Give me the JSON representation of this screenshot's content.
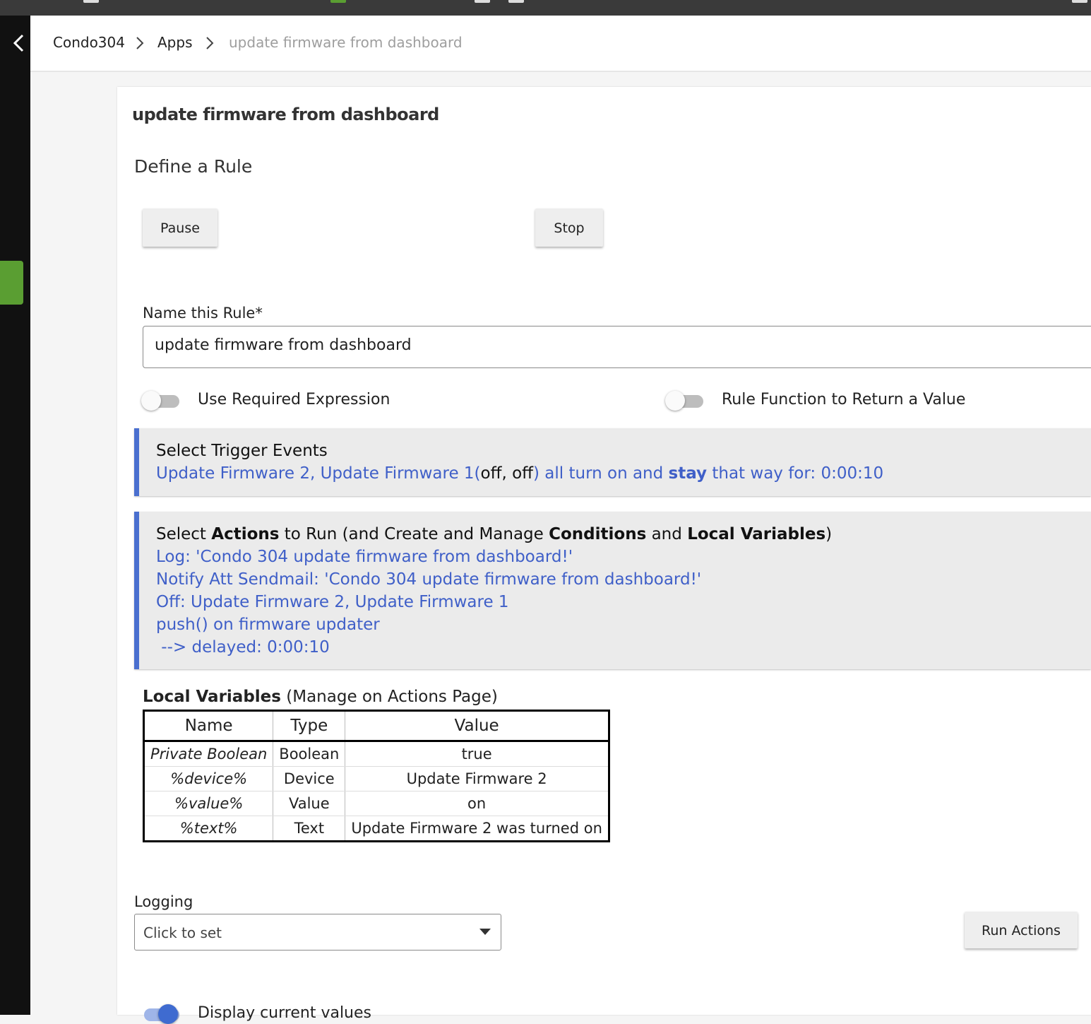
{
  "breadcrumb": {
    "hub": "Condo304",
    "apps": "Apps",
    "current": "update firmware from dashboard"
  },
  "app": {
    "title": "update firmware from dashboard",
    "subtitle": "Define a Rule"
  },
  "buttons": {
    "pause": "Pause",
    "stop": "Stop",
    "run_actions": "Run Actions"
  },
  "name_field": {
    "label": "Name this Rule*",
    "value": "update firmware from dashboard"
  },
  "toggles": {
    "required_expression": {
      "label": "Use Required Expression",
      "on": false
    },
    "rule_function": {
      "label": "Rule Function to Return a Value",
      "on": false
    },
    "display_values": {
      "label": "Display current values",
      "on": true
    }
  },
  "triggers": {
    "heading": "Select Trigger Events",
    "line_devices": "Update Firmware 2, Update Firmware 1(",
    "line_state_1": "off",
    "line_sep": ", ",
    "line_state_2": "off",
    "line_mid": ") all turn on and ",
    "line_stay": "stay",
    "line_end": " that way for: 0:00:10"
  },
  "actions": {
    "heading_1": "Select ",
    "heading_bold_1": "Actions",
    "heading_2": " to Run (and Create and Manage ",
    "heading_bold_2": "Conditions",
    "heading_3": " and ",
    "heading_bold_3": "Local Variables",
    "heading_4": ")",
    "items": [
      "Log: 'Condo 304 update firmware from dashboard!'",
      "Notify Att Sendmail: 'Condo 304 update firmware from dashboard!'",
      "Off: Update Firmware 2, Update Firmware 1",
      "push() on firmware updater",
      " --> delayed: 0:00:10"
    ]
  },
  "local_variables": {
    "title_bold": "Local Variables",
    "title_rest": " (Manage on Actions Page)",
    "columns": [
      "Name",
      "Type",
      "Value"
    ],
    "rows": [
      {
        "name": "Private Boolean",
        "type": "Boolean",
        "value": "true"
      },
      {
        "name": "%device%",
        "type": "Device",
        "value": "Update Firmware 2"
      },
      {
        "name": "%value%",
        "type": "Value",
        "value": "on"
      },
      {
        "name": "%text%",
        "type": "Text",
        "value": "Update Firmware 2 was turned on"
      }
    ]
  },
  "logging": {
    "label": "Logging",
    "value": "Click to set"
  },
  "colors": {
    "accent_blue": "#3f5fc8",
    "section_border": "#4a6fcf",
    "sidebar_green": "#5a9e32"
  }
}
